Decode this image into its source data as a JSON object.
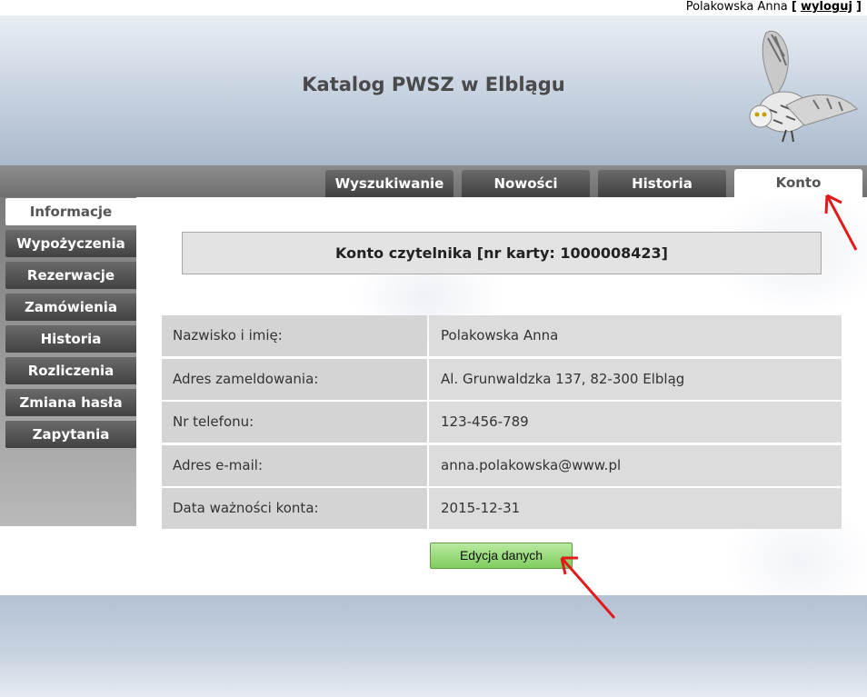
{
  "topbar": {
    "user_name": "Polakowska Anna",
    "bracket_open": "[",
    "logout_label": "wyloguj",
    "bracket_close": "]"
  },
  "header": {
    "title": "Katalog PWSZ w Elblągu"
  },
  "nav": {
    "tabs": [
      {
        "label": "Wyszukiwanie",
        "active": false
      },
      {
        "label": "Nowości",
        "active": false
      },
      {
        "label": "Historia",
        "active": false
      },
      {
        "label": "Konto",
        "active": true
      }
    ]
  },
  "sidebar": {
    "items": [
      {
        "label": "Informacje",
        "active": true
      },
      {
        "label": "Wypożyczenia",
        "active": false
      },
      {
        "label": "Rezerwacje",
        "active": false
      },
      {
        "label": "Zamówienia",
        "active": false
      },
      {
        "label": "Historia",
        "active": false
      },
      {
        "label": "Rozliczenia",
        "active": false
      },
      {
        "label": "Zmiana hasła",
        "active": false
      },
      {
        "label": "Zapytania",
        "active": false
      }
    ]
  },
  "account": {
    "title": "Konto czytelnika [nr karty: 1000008423]",
    "rows": [
      {
        "label": "Nazwisko i imię:",
        "value": "Polakowska Anna"
      },
      {
        "label": "Adres zameldowania:",
        "value": "Al. Grunwaldzka 137, 82-300 Elbląg"
      },
      {
        "label": "Nr telefonu:",
        "value": "123-456-789"
      },
      {
        "label": "Adres e-mail:",
        "value": "anna.polakowska@www.pl"
      },
      {
        "label": "Data ważności konta:",
        "value": "2015-12-31"
      }
    ],
    "edit_button": "Edycja danych"
  },
  "colors": {
    "accent_button": "#7fcc5c",
    "tab_dark": "#404040",
    "annotation_arrow": "#e01b1b"
  },
  "icons": {
    "logo": "owl-icon",
    "annotation": "red-arrow-icon"
  }
}
